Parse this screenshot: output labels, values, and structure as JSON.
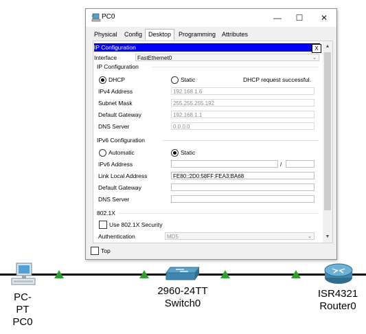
{
  "window": {
    "title": "PC0",
    "controls": [
      "—",
      "☐",
      "✕"
    ]
  },
  "tabs": [
    {
      "label": "Physical"
    },
    {
      "label": "Config"
    },
    {
      "label": "Desktop"
    },
    {
      "label": "Programming"
    },
    {
      "label": "Attributes"
    }
  ],
  "active_tab": "Desktop",
  "ip_config": {
    "header": "IP Configuration",
    "close_label": "X",
    "interface_label": "Interface",
    "interface_value": "FastEthernet0",
    "ipv4_section": "IP Configuration",
    "dhcp_label": "DHCP",
    "static_label": "Static",
    "mode": "DHCP",
    "status": "DHCP request successful.",
    "ipv4_address_label": "IPv4 Address",
    "ipv4_address": "192.168.1.6",
    "subnet_mask_label": "Subnet Mask",
    "subnet_mask": "255.255.255.192",
    "default_gateway_label": "Default Gateway",
    "default_gateway": "192.168.1.1",
    "dns_server_label": "DNS Server",
    "dns_server": "0.0.0.0",
    "ipv6_section": "IPv6 Configuration",
    "ipv6_automatic_label": "Automatic",
    "ipv6_static_label": "Static",
    "ipv6_mode": "Static",
    "ipv6_address_label": "IPv6 Address",
    "ipv6_address": "",
    "prefix_separator": "/",
    "prefix_length": "",
    "link_local_label": "Link Local Address",
    "link_local": "FE80::2D0:58FF:FEA3:BA68",
    "ipv6_gateway_label": "Default Gateway",
    "ipv6_gateway": "",
    "ipv6_dns_label": "DNS Server",
    "ipv6_dns": "",
    "dot1x_section": "802.1X",
    "use_8021x_label": "Use 802.1X Security",
    "use_8021x": false,
    "authentication_label": "Authentication",
    "authentication_value": "MD5"
  },
  "top_checkbox_label": "Top",
  "devices": [
    {
      "model": "PC-PT",
      "name": "PC0"
    },
    {
      "model": "2960-24TT",
      "name": "Switch0"
    },
    {
      "model": "ISR4321",
      "name": "Router0"
    }
  ],
  "colors": {
    "link": "#000000",
    "link_up": "#2fa02f",
    "selection_bar": "#0000ff"
  }
}
